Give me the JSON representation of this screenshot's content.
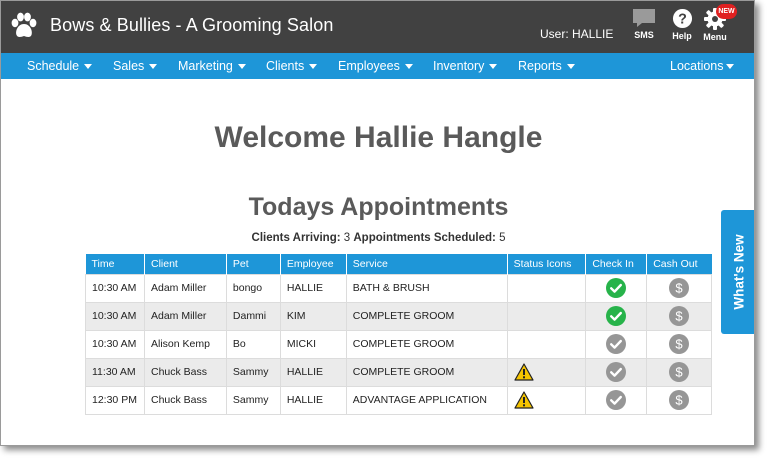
{
  "header": {
    "brand": "Bows & Bullies - A Grooming Salon",
    "user_label": "User: HALLIE",
    "icons": [
      {
        "name": "sms-icon",
        "label": "SMS"
      },
      {
        "name": "help-icon",
        "label": "Help"
      },
      {
        "name": "gear-icon",
        "label": "Menu"
      }
    ],
    "new_badge": "NEW"
  },
  "nav": {
    "items": [
      "Schedule",
      "Sales",
      "Marketing",
      "Clients",
      "Employees",
      "Inventory",
      "Reports"
    ],
    "right_item": "Locations"
  },
  "main": {
    "welcome": "Welcome Hallie Hangle",
    "todays_title": "Todays Appointments",
    "clients_arriving_label": "Clients Arriving:",
    "clients_arriving": "3",
    "appointments_scheduled_label": "Appointments Scheduled:",
    "appointments_scheduled": "5"
  },
  "table": {
    "headers": [
      "Time",
      "Client",
      "Pet",
      "Employee",
      "Service",
      "Status Icons",
      "Check In",
      "Cash Out"
    ],
    "rows": [
      {
        "time": "10:30 AM",
        "client": "Adam Miller",
        "pet": "bongo",
        "employee": "HALLIE",
        "service": "BATH & BRUSH",
        "warning": false,
        "checked_in": true
      },
      {
        "time": "10:30 AM",
        "client": "Adam Miller",
        "pet": "Dammi",
        "employee": "KIM",
        "service": "COMPLETE GROOM",
        "warning": false,
        "checked_in": true
      },
      {
        "time": "10:30 AM",
        "client": "Alison Kemp",
        "pet": "Bo",
        "employee": "MICKI",
        "service": "COMPLETE GROOM",
        "warning": false,
        "checked_in": false
      },
      {
        "time": "11:30 AM",
        "client": "Chuck Bass",
        "pet": "Sammy",
        "employee": "HALLIE",
        "service": "COMPLETE GROOM",
        "warning": true,
        "checked_in": false
      },
      {
        "time": "12:30 PM",
        "client": "Chuck Bass",
        "pet": "Sammy",
        "employee": "HALLIE",
        "service": "ADVANTAGE APPLICATION",
        "warning": true,
        "checked_in": false
      }
    ]
  },
  "whats_new": "What's New",
  "colors": {
    "header_bg": "#414141",
    "nav_bg": "#1e96d8",
    "checked_in_green": "#27b34a",
    "inactive_gray": "#969696",
    "warning_yellow": "#f5c400",
    "heading_gray": "#5a5a5a"
  }
}
